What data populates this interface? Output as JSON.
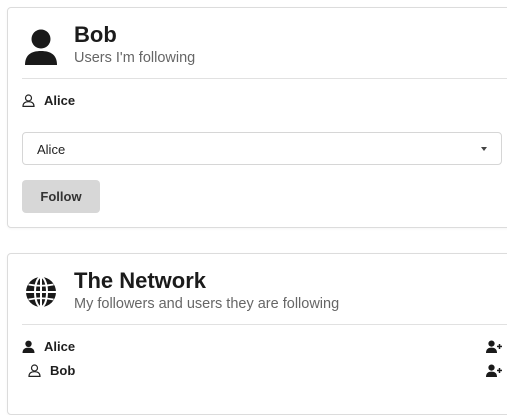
{
  "profile_card": {
    "name": "Bob",
    "subtitle": "Users I'm following",
    "icon": "user-solid-icon",
    "following": [
      {
        "name": "Alice",
        "icon": "user-outline-icon"
      }
    ],
    "select": {
      "value": "Alice",
      "icon": "caret-down-icon"
    },
    "follow_button": "Follow"
  },
  "network_card": {
    "title": "The Network",
    "subtitle": "My followers and users they are following",
    "icon": "globe-icon",
    "rows": [
      {
        "name": "Alice",
        "icon": "user-solid-icon",
        "action_icon": "user-plus-icon"
      },
      {
        "name": "Bob",
        "icon": "user-outline-icon",
        "action_icon": "user-plus-icon"
      }
    ]
  }
}
